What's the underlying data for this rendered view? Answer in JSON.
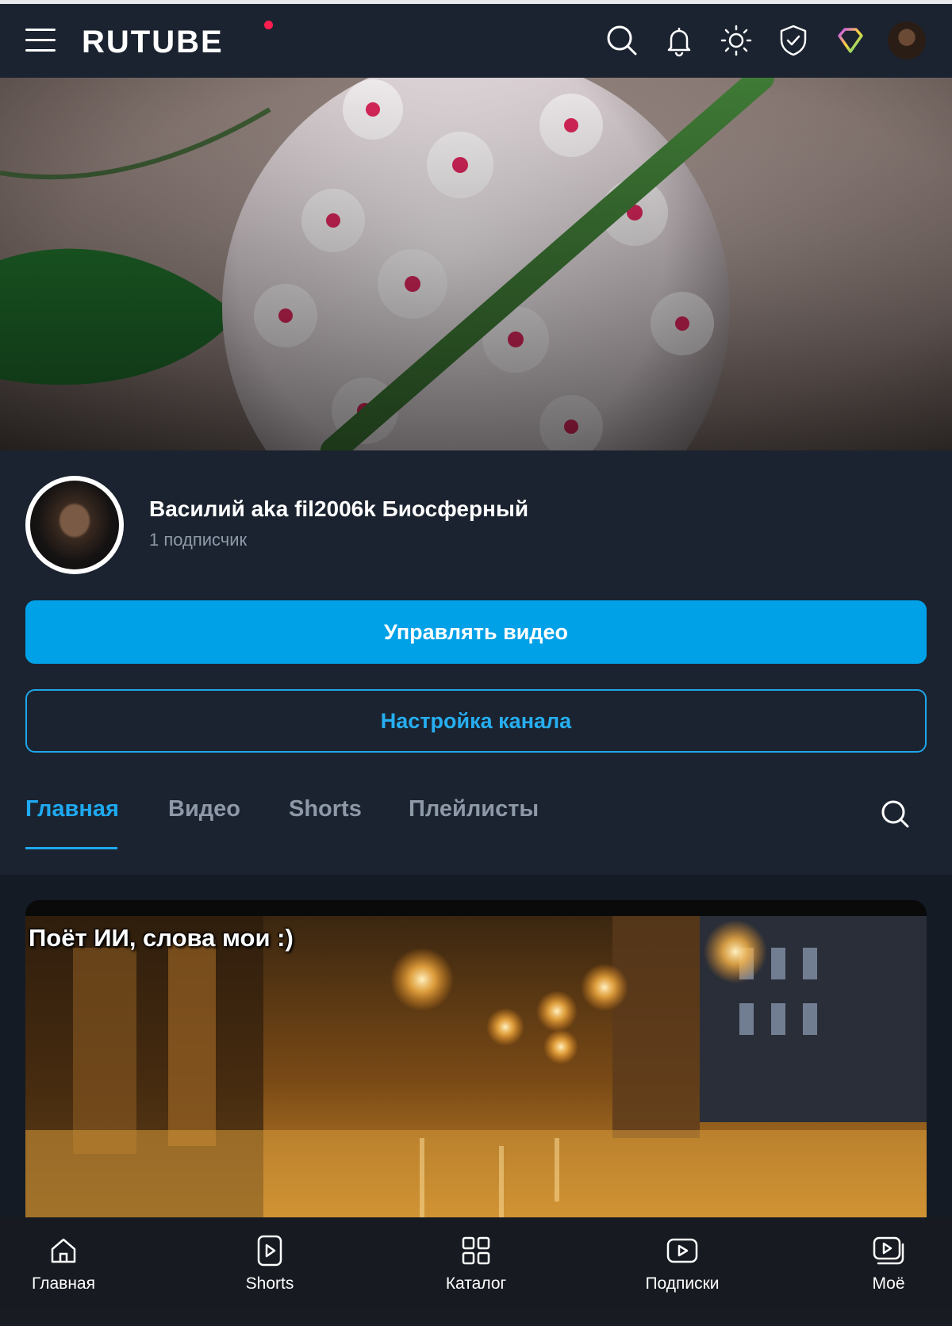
{
  "header": {
    "logo": "RUTUBE",
    "icons": [
      "menu-icon",
      "search-icon",
      "bell-icon",
      "sun-icon",
      "shield-icon",
      "diamond-icon",
      "avatar"
    ]
  },
  "channel": {
    "name": "Василий aka fil2006k Биосферный",
    "subscribers": "1 подписчик",
    "manage_button": "Управлять видео",
    "settings_button": "Настройка канала"
  },
  "tabs": [
    {
      "label": "Главная",
      "active": true
    },
    {
      "label": "Видео",
      "active": false
    },
    {
      "label": "Shorts",
      "active": false
    },
    {
      "label": "Плейлисты",
      "active": false
    }
  ],
  "featured_video": {
    "title": "Поёт ИИ, слова мои :)"
  },
  "bottom_nav": [
    {
      "label": "Главная",
      "icon": "home-icon"
    },
    {
      "label": "Shorts",
      "icon": "shorts-icon"
    },
    {
      "label": "Каталог",
      "icon": "catalog-icon"
    },
    {
      "label": "Подписки",
      "icon": "subscriptions-icon"
    },
    {
      "label": "Моё",
      "icon": "my-videos-icon"
    }
  ],
  "colors": {
    "background": "#1b2330",
    "accent": "#00a1e7",
    "brand_dot": "#ff1e4f"
  }
}
